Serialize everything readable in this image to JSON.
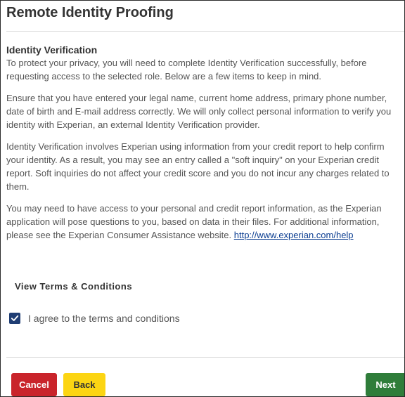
{
  "page": {
    "title": "Remote Identity Proofing"
  },
  "section": {
    "heading": "Identity Verification",
    "intro_lines": [
      "To protect your privacy, you will need to complete Identity Verification successfully, before",
      "requesting access to the selected role. Below are a few items to keep in mind."
    ],
    "para1_lines": [
      "Ensure that you have entered your legal name, current home address, primary phone number,",
      "date of birth and E-mail address correctly. We will only collect personal information to verify you",
      "identity with Experian, an external Identity Verification provider."
    ],
    "para2_lines": [
      "Identity Verification involves Experian using information from your credit report to help confirm",
      "your identity. As a result, you may see an entry called a \"soft inquiry\" on your Experian credit",
      "report. Soft inquiries do not affect your credit score and you do not incur any charges related to",
      "them."
    ],
    "para3_lines": [
      "You may need to have access to your personal and credit report information, as the Experian",
      "application will pose questions to you, based on data in their files. For additional information,"
    ],
    "para3_last_prefix": "please see the Experian Consumer Assistance website. ",
    "help_link": "http://www.experian.com/help"
  },
  "terms": {
    "heading": "View Terms & Conditions",
    "agree_label": "I agree to the terms and conditions",
    "agree_checked": true
  },
  "footer": {
    "cancel_label": "Cancel",
    "back_label": "Back",
    "next_label": "Next"
  },
  "colors": {
    "cancel": "#c9242b",
    "back": "#fcd513",
    "next": "#2f7d3a",
    "checkbox": "#1f3d73",
    "link": "#0b3d91"
  },
  "icons": {
    "checkbox": "checkmark-icon"
  }
}
